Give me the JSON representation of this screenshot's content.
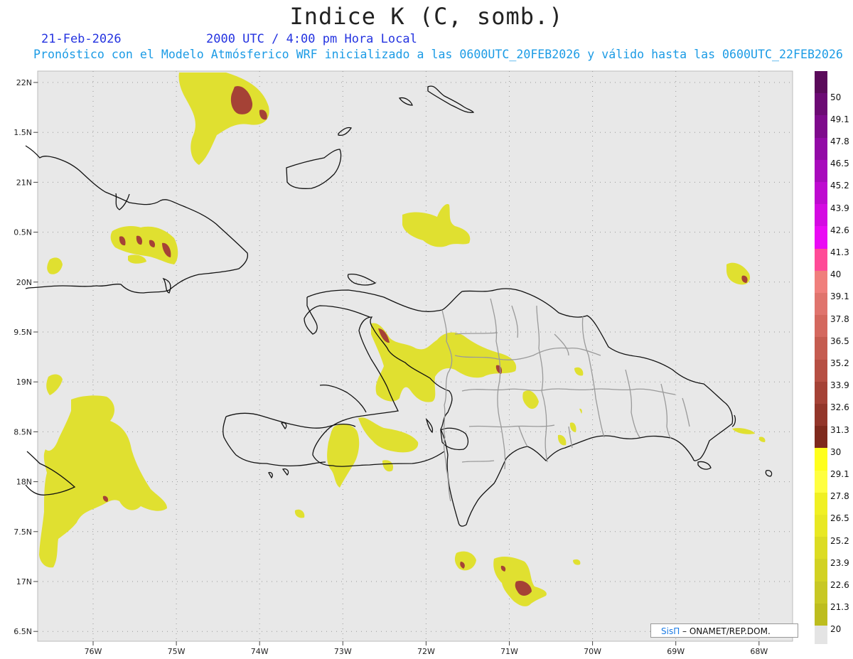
{
  "header": {
    "title": "Indice K (C, somb.)",
    "date": "21-Feb-2026",
    "valid_time": "2000 UTC / 4:00 pm Hora Local",
    "forecast_line": "Pronóstico con el Modelo Atmósferico WRF inicializado a las 0600UTC_20FEB2026 y válido hasta las  0600UTC_22FEB2026"
  },
  "lat_labels": [
    "22N",
    "1.5N",
    "21N",
    "0.5N",
    "20N",
    "9.5N",
    "19N",
    "8.5N",
    "18N",
    "7.5N",
    "17N",
    "6.5N"
  ],
  "lon_labels": [
    "76W",
    "75W",
    "74W",
    "73W",
    "72W",
    "71W",
    "70W",
    "69W",
    "68W"
  ],
  "colorbar": {
    "labels": [
      "50",
      "49.1",
      "47.8",
      "46.5",
      "45.2",
      "43.9",
      "42.6",
      "41.3",
      "40",
      "39.1",
      "37.8",
      "36.5",
      "35.2",
      "33.9",
      "32.6",
      "31.3",
      "30",
      "29.1",
      "27.8",
      "26.5",
      "25.2",
      "23.9",
      "22.6",
      "21.3",
      "20"
    ],
    "colors": [
      "#5a0a5a",
      "#6c0a74",
      "#7e0a8c",
      "#920aa6",
      "#a80abc",
      "#be0ad0",
      "#d40ae2",
      "#ea0af4",
      "#ff4b97",
      "#f07f7c",
      "#e0746d",
      "#d4685e",
      "#c55c50",
      "#b64f43",
      "#a54236",
      "#93362a",
      "#7f2a1d",
      "#ffff1c",
      "#ffff40",
      "#f0f022",
      "#e8e822",
      "#dcdc22",
      "#d2d222",
      "#c8c824",
      "#bdbd1e"
    ],
    "low_color": "#e4e4e4"
  },
  "credit": {
    "brand": "SisΠ",
    "text": " – ONAMET/REP.DOM."
  }
}
